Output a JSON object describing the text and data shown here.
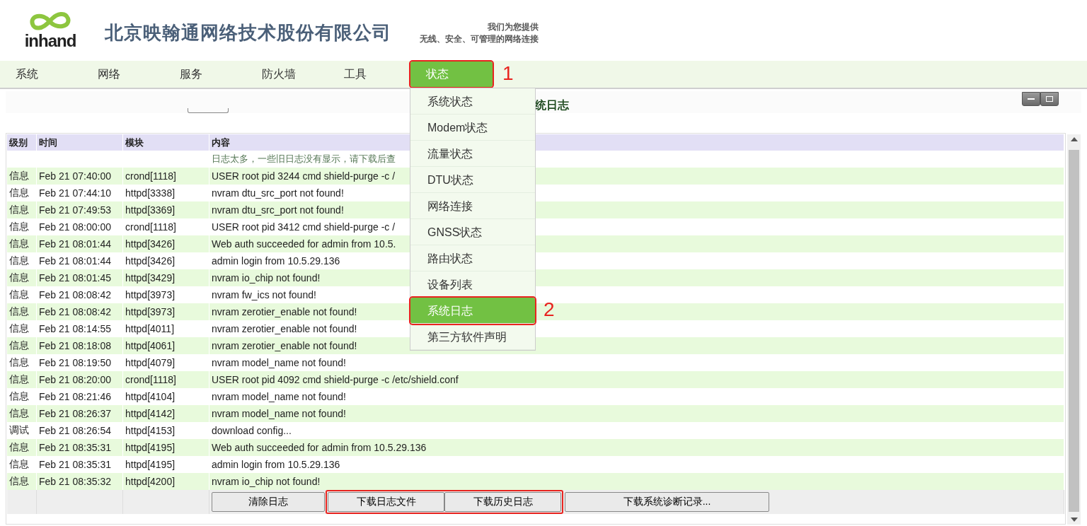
{
  "header": {
    "logo_text": "inhand",
    "company": "北京映翰通网络技术股份有限公司",
    "slogan": [
      "我们为您提供",
      "无线、安全、可管理的网络连接"
    ]
  },
  "nav": [
    {
      "label": "系统",
      "selected": false,
      "highlighted": false
    },
    {
      "label": "网络",
      "selected": false,
      "highlighted": false
    },
    {
      "label": "服务",
      "selected": false,
      "highlighted": false
    },
    {
      "label": "防火墙",
      "selected": false,
      "highlighted": false
    },
    {
      "label": "工具",
      "selected": false,
      "highlighted": false
    },
    {
      "label": "状态",
      "selected": true,
      "highlighted": true,
      "annotation": "1"
    }
  ],
  "dropdown": [
    {
      "label": "系统状态",
      "selected": false,
      "highlighted": false
    },
    {
      "label": "Modem状态",
      "selected": false,
      "highlighted": false
    },
    {
      "label": "流量状态",
      "selected": false,
      "highlighted": false
    },
    {
      "label": "DTU状态",
      "selected": false,
      "highlighted": false
    },
    {
      "label": "网络连接",
      "selected": false,
      "highlighted": false
    },
    {
      "label": "GNSS状态",
      "selected": false,
      "highlighted": false
    },
    {
      "label": "路由状态",
      "selected": false,
      "highlighted": false
    },
    {
      "label": "设备列表",
      "selected": false,
      "highlighted": false
    },
    {
      "label": "系统日志",
      "selected": true,
      "highlighted": true,
      "annotation": "2"
    },
    {
      "label": "第三方软件声明",
      "selected": false,
      "highlighted": false
    }
  ],
  "panel": {
    "title": "统日志"
  },
  "table": {
    "columns": [
      "级别",
      "时间",
      "模块",
      "内容"
    ],
    "notice": "日志太多，一些旧日志没有显示，请下载后查",
    "rows": [
      [
        "信息",
        "Feb 21 07:40:00",
        "crond[1118]",
        "USER root pid 3244 cmd shield-purge -c /"
      ],
      [
        "信息",
        "Feb 21 07:44:10",
        "httpd[3338]",
        "nvram dtu_src_port not found!"
      ],
      [
        "信息",
        "Feb 21 07:49:53",
        "httpd[3369]",
        "nvram dtu_src_port not found!"
      ],
      [
        "信息",
        "Feb 21 08:00:00",
        "crond[1118]",
        "USER root pid 3412 cmd shield-purge -c /"
      ],
      [
        "信息",
        "Feb 21 08:01:44",
        "httpd[3426]",
        "Web auth succeeded for admin from 10.5."
      ],
      [
        "信息",
        "Feb 21 08:01:44",
        "httpd[3426]",
        "admin login from 10.5.29.136"
      ],
      [
        "信息",
        "Feb 21 08:01:45",
        "httpd[3429]",
        "nvram io_chip not found!"
      ],
      [
        "信息",
        "Feb 21 08:08:42",
        "httpd[3973]",
        "nvram fw_ics not found!"
      ],
      [
        "信息",
        "Feb 21 08:08:42",
        "httpd[3973]",
        "nvram zerotier_enable not found!"
      ],
      [
        "信息",
        "Feb 21 08:14:55",
        "httpd[4011]",
        "nvram zerotier_enable not found!"
      ],
      [
        "信息",
        "Feb 21 08:18:08",
        "httpd[4061]",
        "nvram zerotier_enable not found!"
      ],
      [
        "信息",
        "Feb 21 08:19:50",
        "httpd[4079]",
        "nvram model_name not found!"
      ],
      [
        "信息",
        "Feb 21 08:20:00",
        "crond[1118]",
        "USER root pid 4092 cmd shield-purge -c /etc/shield.conf"
      ],
      [
        "信息",
        "Feb 21 08:21:46",
        "httpd[4104]",
        "nvram model_name not found!"
      ],
      [
        "信息",
        "Feb 21 08:26:37",
        "httpd[4142]",
        "nvram model_name not found!"
      ],
      [
        "调试",
        "Feb 21 08:26:54",
        "httpd[4153]",
        "download config..."
      ],
      [
        "信息",
        "Feb 21 08:35:31",
        "httpd[4195]",
        "Web auth succeeded for admin from 10.5.29.136"
      ],
      [
        "信息",
        "Feb 21 08:35:31",
        "httpd[4195]",
        "admin login from 10.5.29.136"
      ],
      [
        "信息",
        "Feb 21 08:35:32",
        "httpd[4200]",
        "nvram io_chip not found!"
      ]
    ]
  },
  "buttons": [
    {
      "label": "清除日志",
      "highlighted": false
    },
    {
      "label": "下载日志文件",
      "highlighted": true
    },
    {
      "label": "下载历史日志",
      "highlighted": true
    },
    {
      "label": "下载系统诊断记录...",
      "highlighted": false
    }
  ]
}
